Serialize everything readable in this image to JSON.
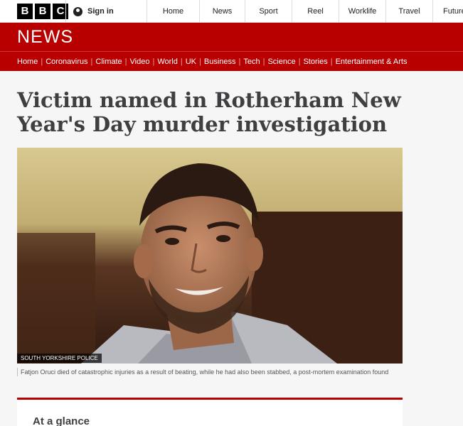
{
  "brand": {
    "logo_letters": [
      "B",
      "B",
      "C"
    ]
  },
  "signin": {
    "label": "Sign in",
    "icon": "user-icon"
  },
  "top_nav": [
    "Home",
    "News",
    "Sport",
    "Reel",
    "Worklife",
    "Travel",
    "Future"
  ],
  "banner": {
    "title": "NEWS",
    "color": "#b80000"
  },
  "section_nav": [
    "Home",
    "Coronavirus",
    "Climate",
    "Video",
    "World",
    "UK",
    "Business",
    "Tech",
    "Science",
    "Stories",
    "Entertainment & Arts"
  ],
  "article": {
    "headline": "Victim named in Rotherham New Year's Day murder investigation",
    "image_credit": "SOUTH YORKSHIRE POLICE",
    "caption": "Fatjon Oruci died of catastrophic injuries as a result of beating, while he had also been stabbed, a post-mortem examination found",
    "at_a_glance_title": "At a glance"
  }
}
